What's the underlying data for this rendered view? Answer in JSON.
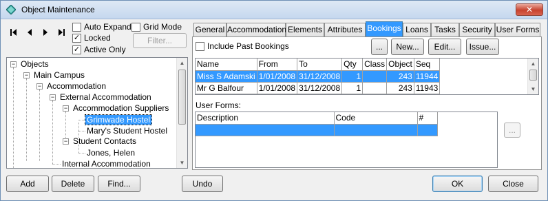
{
  "window": {
    "title": "Object Maintenance",
    "close_label": "✕"
  },
  "left": {
    "checkboxes": [
      {
        "label": "Auto Expand",
        "checked": false
      },
      {
        "label": "Grid Mode",
        "checked": false
      },
      {
        "label": "Locked",
        "checked": true
      },
      {
        "label": "Active Only",
        "checked": true
      }
    ],
    "filter_button": "Filter...",
    "tree": [
      {
        "label": "Objects",
        "depth": 0,
        "expanded": true
      },
      {
        "label": "Main Campus",
        "depth": 1,
        "expanded": true
      },
      {
        "label": "Accommodation",
        "depth": 2,
        "expanded": true
      },
      {
        "label": "External Accommodation",
        "depth": 3,
        "expanded": true
      },
      {
        "label": "Accommodation Suppliers",
        "depth": 4,
        "expanded": true
      },
      {
        "label": "Grimwade Hostel",
        "depth": 5,
        "selected": true
      },
      {
        "label": "Mary's Student Hostel",
        "depth": 5
      },
      {
        "label": "Student Contacts",
        "depth": 4,
        "expanded": true
      },
      {
        "label": "Jones, Helen",
        "depth": 5
      },
      {
        "label": "Internal Accommodation",
        "depth": 3
      }
    ]
  },
  "tabs": [
    {
      "label": "General"
    },
    {
      "label": "Accommodation"
    },
    {
      "label": "Elements"
    },
    {
      "label": "Attributes"
    },
    {
      "label": "Bookings",
      "active": true
    },
    {
      "label": "Loans"
    },
    {
      "label": "Tasks"
    },
    {
      "label": "Security"
    },
    {
      "label": "User Forms"
    }
  ],
  "bookings": {
    "include_past_label": "Include Past Bookings",
    "include_past_checked": false,
    "buttons": {
      "ellipsis": "...",
      "new": "New...",
      "edit": "Edit...",
      "issue": "Issue..."
    },
    "columns": [
      "Name",
      "From",
      "To",
      "Qty",
      "Class",
      "Object",
      "Seq"
    ],
    "rows": [
      {
        "cells": [
          "Miss S Adamski",
          "1/01/2008",
          "31/12/2008",
          "1",
          "",
          "243",
          "11944"
        ],
        "selected": true
      },
      {
        "cells": [
          "Mr G Balfour",
          "1/01/2008",
          "31/12/2008",
          "1",
          "",
          "243",
          "11943"
        ],
        "selected": false
      }
    ]
  },
  "user_forms": {
    "label": "User Forms:",
    "columns": [
      "Description",
      "Code",
      "#"
    ],
    "ellipsis": "..."
  },
  "footer": {
    "add": "Add",
    "delete": "Delete",
    "find": "Find...",
    "undo": "Undo",
    "ok": "OK",
    "close": "Close"
  }
}
